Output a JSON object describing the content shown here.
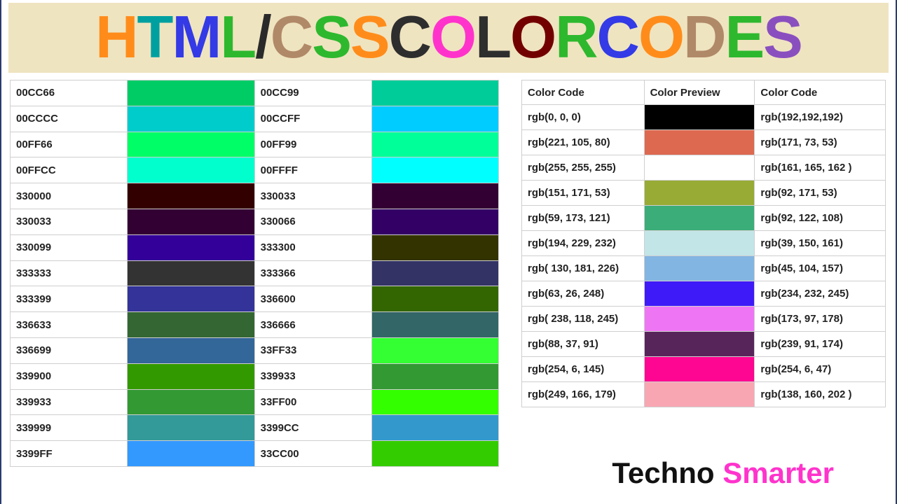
{
  "title": {
    "chars": [
      {
        "t": "H",
        "c": "#ff8c1a"
      },
      {
        "t": "T",
        "c": "#00a0a0"
      },
      {
        "t": "M",
        "c": "#333ae6"
      },
      {
        "t": "L",
        "c": "#2eb82e"
      },
      {
        "t": "/",
        "c": "#2a2a2a"
      },
      {
        "t": "C",
        "c": "#b08968"
      },
      {
        "t": "S",
        "c": "#2eb82e"
      },
      {
        "t": "S",
        "c": "#ff8c1a"
      },
      {
        "t": " ",
        "c": "#000"
      },
      {
        "t": "C",
        "c": "#2e2e2e"
      },
      {
        "t": "O",
        "c": "#ff33cc"
      },
      {
        "t": "L",
        "c": "#2e2e2e"
      },
      {
        "t": "O",
        "c": "#720000"
      },
      {
        "t": "R",
        "c": "#2eb82e"
      },
      {
        "t": " ",
        "c": "#000"
      },
      {
        "t": "C",
        "c": "#333ae6"
      },
      {
        "t": "O",
        "c": "#ff8c1a"
      },
      {
        "t": "D",
        "c": "#b08968"
      },
      {
        "t": "E",
        "c": "#2eb82e"
      },
      {
        "t": "S",
        "c": "#8a4fbf"
      }
    ]
  },
  "hex_rows": [
    {
      "a": "00CC66",
      "ac": "#00CC66",
      "b": "00CC99",
      "bc": "#00CC99"
    },
    {
      "a": "00CCCC",
      "ac": "#00CCCC",
      "b": "00CCFF",
      "bc": "#00CCFF"
    },
    {
      "a": "00FF66",
      "ac": "#00FF66",
      "b": "00FF99",
      "bc": "#00FF99"
    },
    {
      "a": "00FFCC",
      "ac": "#00FFCC",
      "b": "00FFFF",
      "bc": "#00FFFF"
    },
    {
      "a": "330000",
      "ac": "#330000",
      "b": "330033",
      "bc": "#330033"
    },
    {
      "a": "330033",
      "ac": "#330033",
      "b": "330066",
      "bc": "#330066"
    },
    {
      "a": "330099",
      "ac": "#330099",
      "b": "333300",
      "bc": "#333300"
    },
    {
      "a": "333333",
      "ac": "#333333",
      "b": "333366",
      "bc": "#333366"
    },
    {
      "a": "333399",
      "ac": "#333399",
      "b": "336600",
      "bc": "#336600"
    },
    {
      "a": "336633",
      "ac": "#336633",
      "b": "336666",
      "bc": "#336666"
    },
    {
      "a": "336699",
      "ac": "#336699",
      "b": "33FF33",
      "bc": "#33FF33"
    },
    {
      "a": "339900",
      "ac": "#339900",
      "b": "339933",
      "bc": "#339933"
    },
    {
      "a": "339933",
      "ac": "#339933",
      "b": "33FF00",
      "bc": "#33FF00"
    },
    {
      "a": "339999",
      "ac": "#339999",
      "b": "3399CC",
      "bc": "#3399CC"
    },
    {
      "a": "3399FF",
      "ac": "#3399FF",
      "b": "33CC00",
      "bc": "#33CC00"
    }
  ],
  "rgb_headers": {
    "c1": "Color Code",
    "c2": "Color Preview",
    "c3": "Color Code"
  },
  "rgb_rows": [
    {
      "a": "rgb(0, 0, 0)",
      "ac": "rgb(0,0,0)",
      "b": "rgb(192,192,192)"
    },
    {
      "a": "rgb(221, 105, 80)",
      "ac": "rgb(221,105,80)",
      "b": "rgb(171, 73, 53)"
    },
    {
      "a": "rgb(255, 255, 255)",
      "ac": "rgb(255,255,255)",
      "b": "rgb(161, 165, 162 )"
    },
    {
      "a": "rgb(151, 171, 53)",
      "ac": "rgb(151,171,53)",
      "b": "rgb(92, 171, 53)"
    },
    {
      "a": "rgb(59, 173, 121)",
      "ac": "rgb(59,173,121)",
      "b": "rgb(92, 122, 108)"
    },
    {
      "a": "rgb(194, 229, 232)",
      "ac": "rgb(194,229,232)",
      "b": "rgb(39, 150, 161)"
    },
    {
      "a": "rgb( 130, 181, 226)",
      "ac": "rgb(130,181,226)",
      "b": "rgb(45, 104, 157)"
    },
    {
      "a": "rgb(63, 26, 248)",
      "ac": "rgb(63,26,248)",
      "b": "rgb(234, 232, 245)"
    },
    {
      "a": "rgb( 238, 118, 245)",
      "ac": "rgb(238,118,245)",
      "b": "rgb(173, 97, 178)"
    },
    {
      "a": "rgb(88, 37, 91)",
      "ac": "rgb(88,37,91)",
      "b": "rgb(239, 91, 174)"
    },
    {
      "a": "rgb(254, 6, 145)",
      "ac": "rgb(254,6,145)",
      "b": "rgb(254, 6, 47)"
    },
    {
      "a": "rgb(249, 166, 179)",
      "ac": "rgb(249,166,179)",
      "b": "rgb(138, 160, 202 )"
    }
  ],
  "brand": {
    "a": "Techno ",
    "b": "Smarter",
    "ac": "#111",
    "bc": "#ff33cc"
  }
}
